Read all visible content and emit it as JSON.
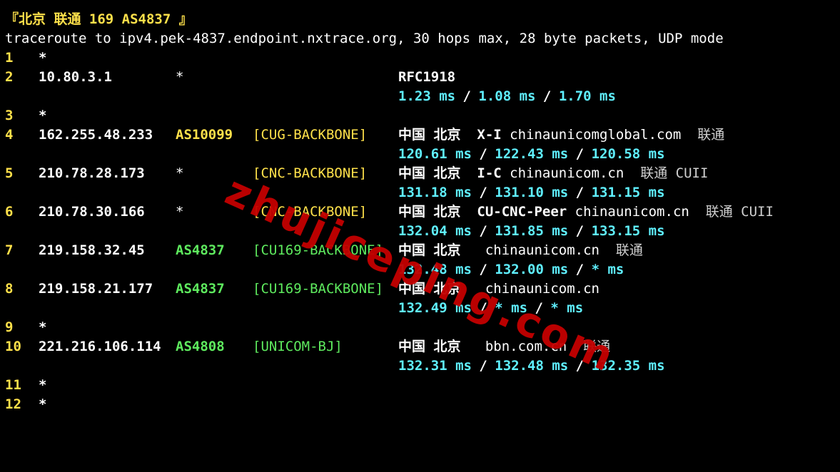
{
  "header": {
    "title": "『北京 联通 169 AS4837 』",
    "command": "traceroute to ipv4.pek-4837.endpoint.nxtrace.org, 30 hops max, 28 byte packets, UDP mode"
  },
  "watermark": "zhujiceping.com",
  "colors": {
    "background": "#000000",
    "hop_number": "#ffe14a",
    "latency": "#5ff0ff",
    "asn_green": "#5eea5e",
    "tag_yellow": "#ffe14a"
  },
  "hops": [
    {
      "hop": "1",
      "star": "*"
    },
    {
      "hop": "2",
      "ip": "10.80.3.1",
      "asn": "*",
      "geo": "RFC1918",
      "rtt": [
        "1.23 ms",
        "1.08 ms",
        "1.70 ms"
      ]
    },
    {
      "hop": "3",
      "star": "*"
    },
    {
      "hop": "4",
      "ip": "162.255.48.233",
      "asn": "AS10099",
      "tag": "[CUG-BACKBONE]",
      "country": "中国",
      "city": "北京",
      "org": "X-I",
      "domain": "chinaunicomglobal.com",
      "isp": "联通",
      "rtt": [
        "120.61 ms",
        "122.43 ms",
        "120.58 ms"
      ]
    },
    {
      "hop": "5",
      "ip": "210.78.28.173",
      "asn": "*",
      "tag": "[CNC-BACKBONE]",
      "country": "中国",
      "city": "北京",
      "org": "I-C",
      "domain": "chinaunicom.cn",
      "isp": "联通 CUII",
      "rtt": [
        "131.18 ms",
        "131.10 ms",
        "131.15 ms"
      ]
    },
    {
      "hop": "6",
      "ip": "210.78.30.166",
      "asn": "*",
      "tag": "[CNC-BACKBONE]",
      "country": "中国",
      "city": "北京",
      "org": "CU-CNC-Peer",
      "domain": "chinaunicom.cn",
      "isp": "联通 CUII",
      "rtt": [
        "132.04 ms",
        "131.85 ms",
        "133.15 ms"
      ]
    },
    {
      "hop": "7",
      "ip": "219.158.32.45",
      "asn": "AS4837",
      "tag": "[CU169-BACKBONE]",
      "country": "中国",
      "city": "北京",
      "org": "",
      "domain": "chinaunicom.cn",
      "isp": "联通",
      "rtt": [
        "132.48 ms",
        "132.00 ms",
        "* ms"
      ]
    },
    {
      "hop": "8",
      "ip": "219.158.21.177",
      "asn": "AS4837",
      "tag": "[CU169-BACKBONE]",
      "country": "中国",
      "city": "北京",
      "org": "",
      "domain": "chinaunicom.cn",
      "isp": "",
      "rtt": [
        "132.49 ms",
        "* ms",
        "* ms"
      ]
    },
    {
      "hop": "9",
      "star": "*"
    },
    {
      "hop": "10",
      "ip": "221.216.106.114",
      "asn": "AS4808",
      "tag": "[UNICOM-BJ]",
      "country": "中国",
      "city": "北京",
      "org": "",
      "domain": "bbn.com.cn",
      "isp": "联通",
      "rtt": [
        "132.31 ms",
        "132.48 ms",
        "132.35 ms"
      ]
    },
    {
      "hop": "11",
      "star": "*"
    },
    {
      "hop": "12",
      "star": "*"
    }
  ],
  "rtt_separator": "/"
}
